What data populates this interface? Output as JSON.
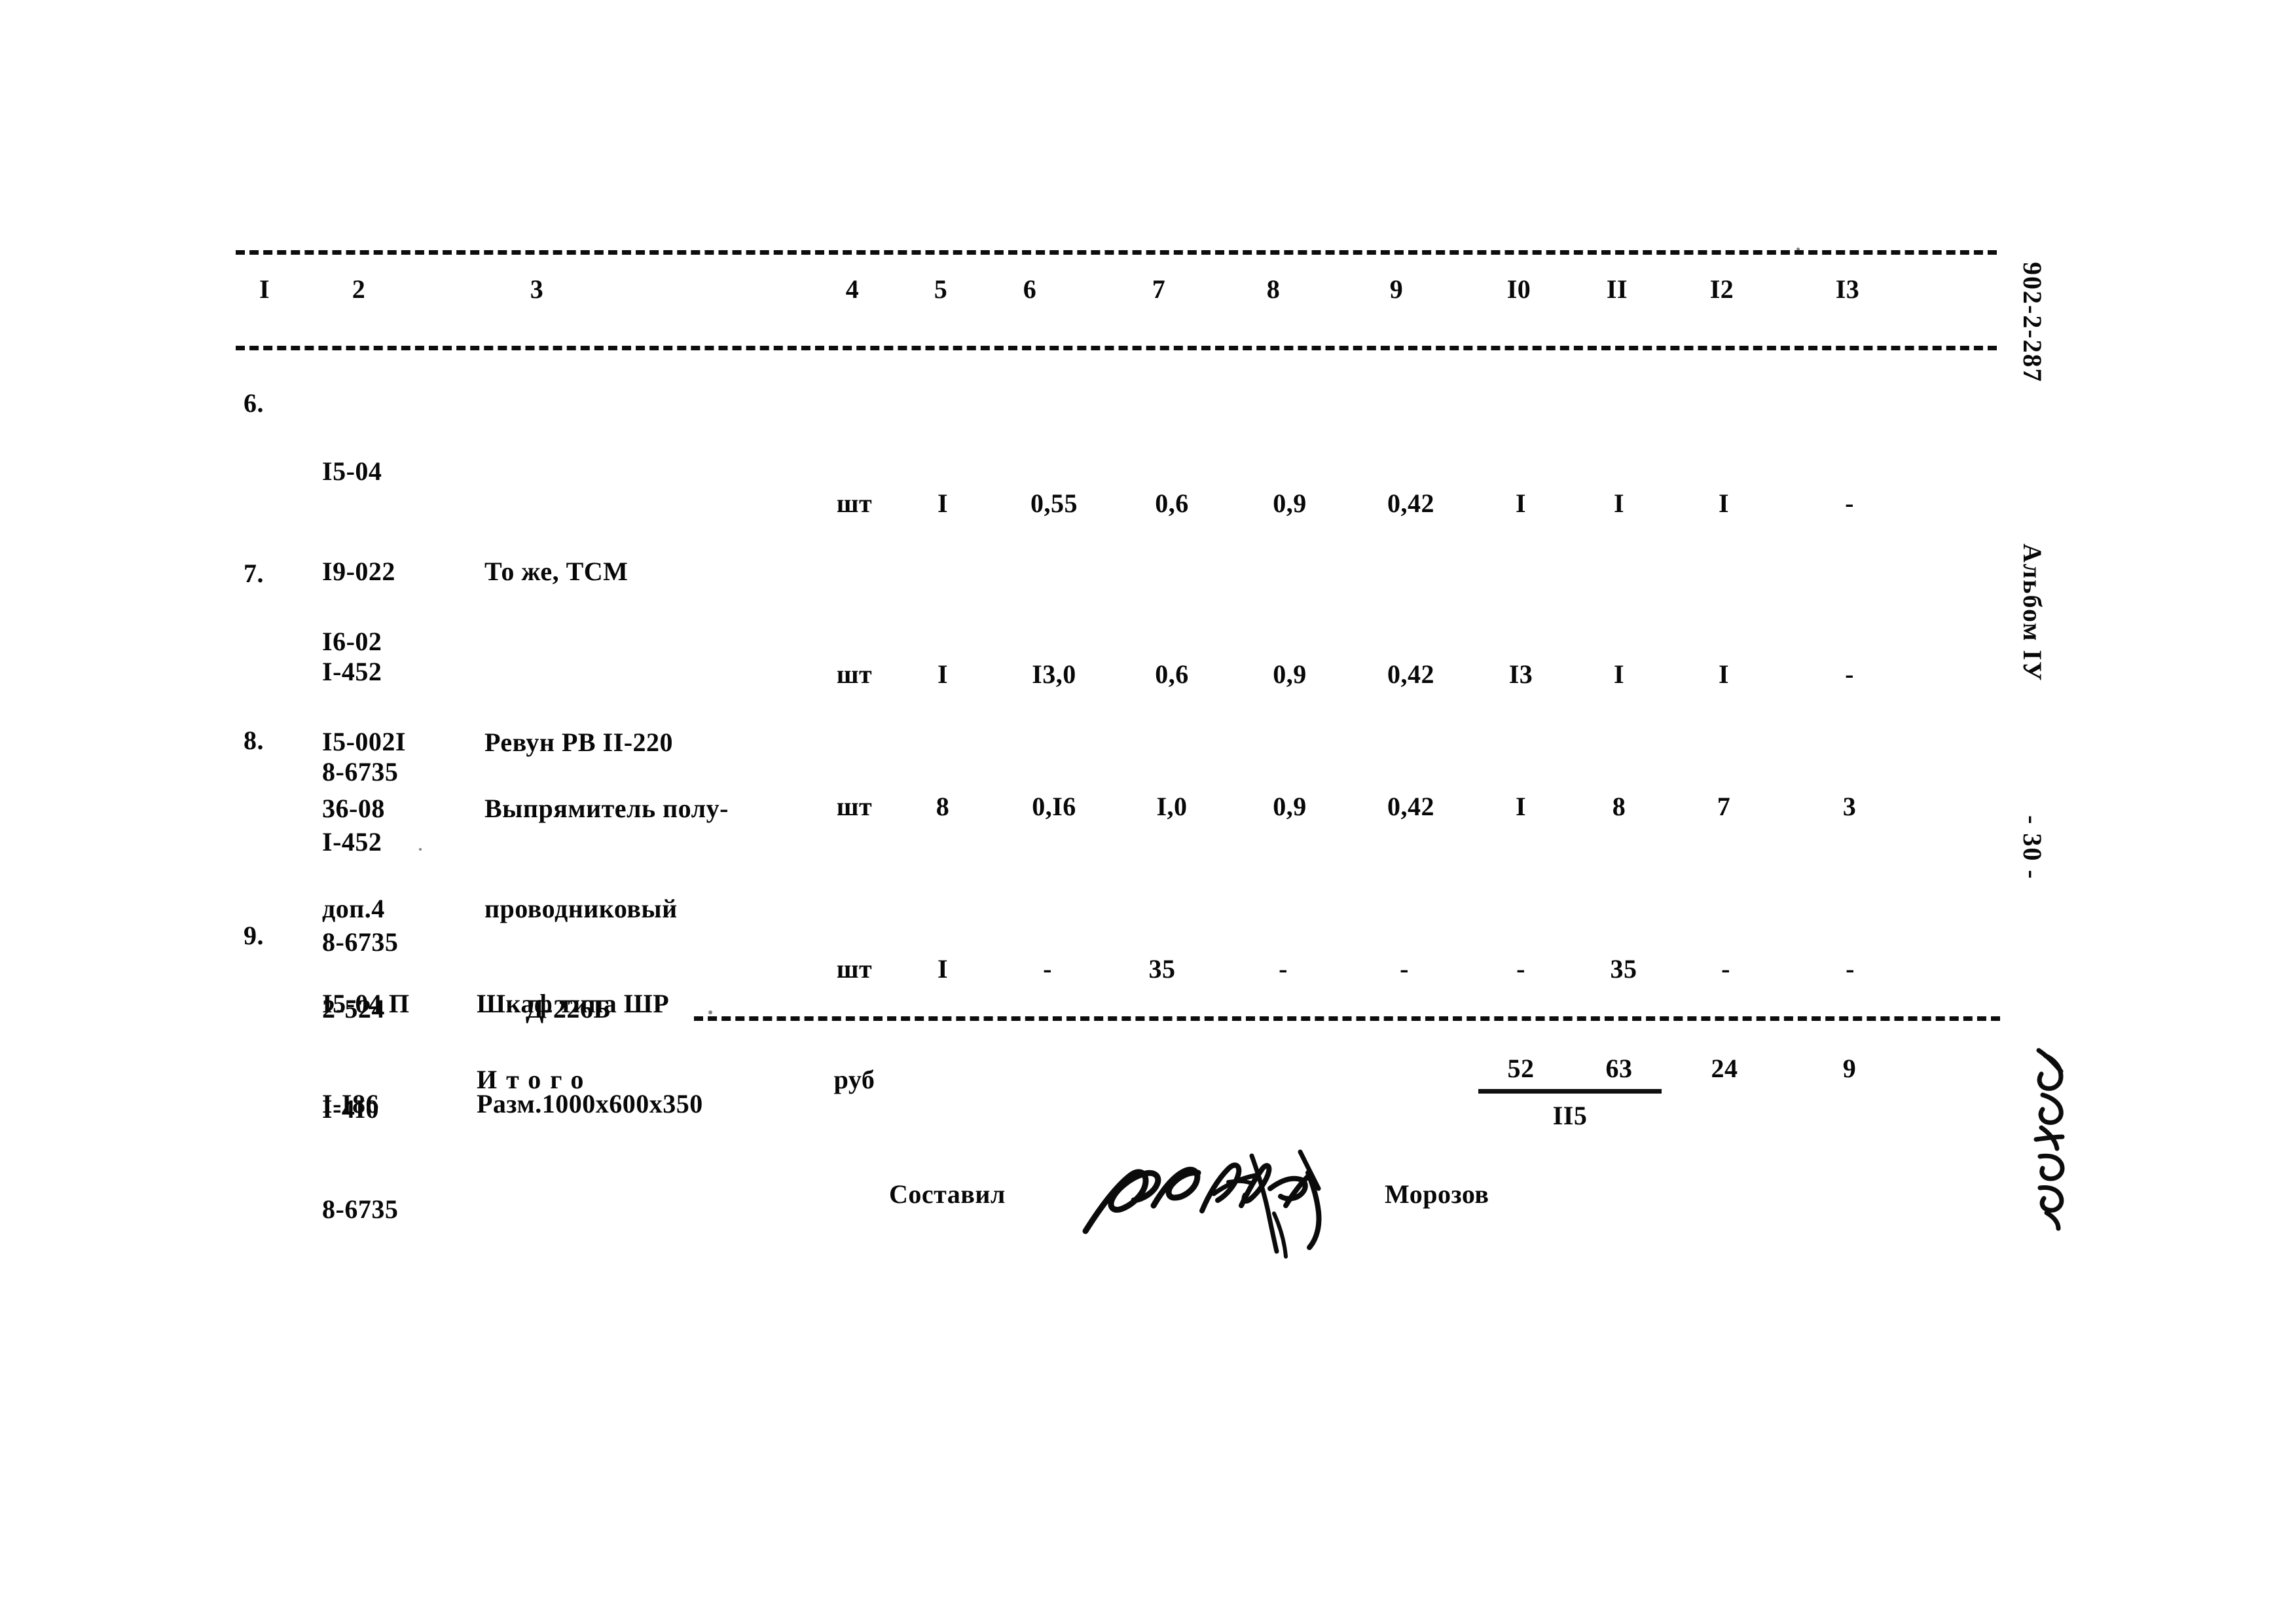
{
  "document": {
    "sheet_code_vertical": "902-2-287",
    "album_vertical": "Альбом IУ",
    "page_number_vertical": "- 30 -",
    "archive_mark_vertical": "№3/9-03"
  },
  "table": {
    "column_headers": [
      "I",
      "2",
      "3",
      "4",
      "5",
      "6",
      "7",
      "8",
      "9",
      "I0",
      "II",
      "I2",
      "I3"
    ],
    "rows": [
      {
        "no": "6.",
        "codes": [
          "I5-04",
          "I9-022",
          "I-452",
          "8-6735"
        ],
        "description": [
          "То же, ТСМ"
        ],
        "unit": "шт",
        "c5": "I",
        "c6": "0,55",
        "c7": "0,6",
        "c8": "0,9",
        "c9": "0,42",
        "c10": "I",
        "c11": "I",
        "c12": "I",
        "c13": "-"
      },
      {
        "no": "7.",
        "codes": [
          "I6-02",
          "I5-002I",
          "I-452",
          "8-6735"
        ],
        "description": [
          "Ревун РВ II-220"
        ],
        "unit": "шт",
        "c5": "I",
        "c6": "I3,0",
        "c7": "0,6",
        "c8": "0,9",
        "c9": "0,42",
        "c10": "I3",
        "c11": "I",
        "c12": "I",
        "c13": "-"
      },
      {
        "no": "8.",
        "codes": [
          "36-08",
          "доп.4",
          "2-524",
          "I-4I0",
          "8-6735"
        ],
        "description": [
          "Выпрямитель полу-",
          "проводниковый",
          "      Д-226Б"
        ],
        "unit": "шт",
        "c5": "8",
        "c6": "0,I6",
        "c7": "I,0",
        "c8": "0,9",
        "c9": "0,42",
        "c10": "I",
        "c11": "8",
        "c12": "7",
        "c13": "3"
      },
      {
        "no": "9.",
        "codes": [
          "I5-04 П",
          "I-I86"
        ],
        "description": [
          "Шкаф типа ШР",
          "Разм.1000х600х350"
        ],
        "unit": "шт",
        "c5": "I",
        "c6": "-",
        "c7": "35",
        "c8": "-",
        "c9": "-",
        "c10": "-",
        "c11": "35",
        "c12": "-",
        "c13": "-"
      }
    ],
    "totals": {
      "label": "Итого",
      "unit": "руб",
      "c10": "52",
      "c11": "63",
      "c12": "24",
      "c13": "9",
      "sum_under": "II5"
    }
  },
  "footer": {
    "compiled_by_label": "Составил",
    "compiled_by_name": "Морозов"
  }
}
